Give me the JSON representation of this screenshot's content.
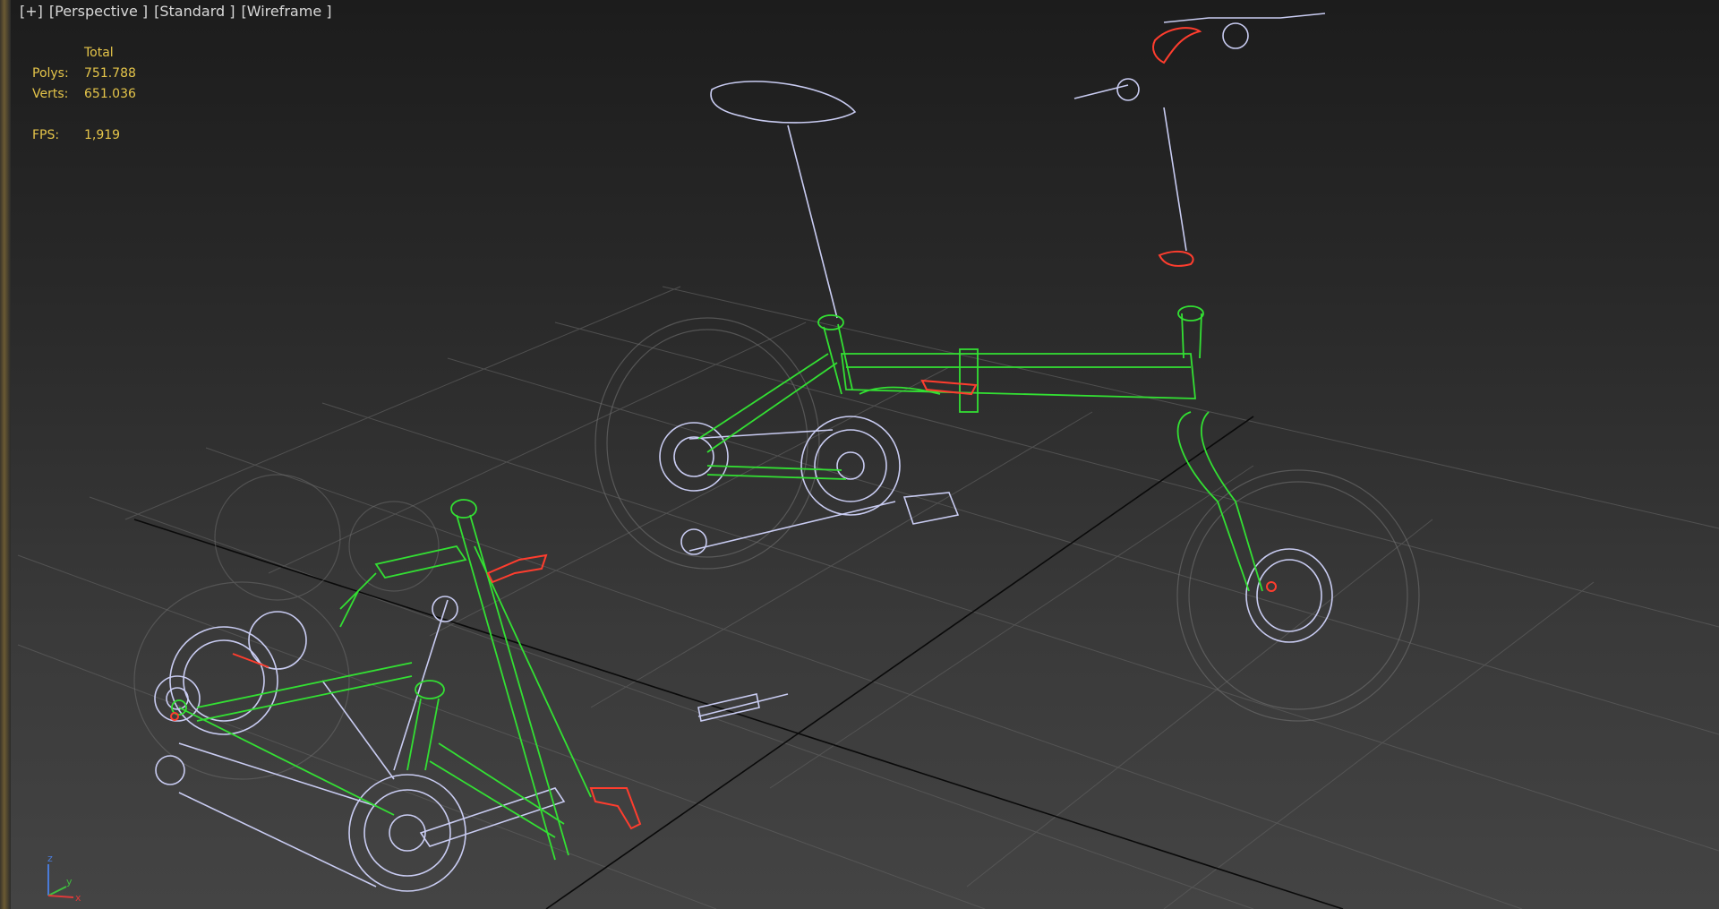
{
  "viewport": {
    "menu": [
      "[+]",
      "[Perspective ]",
      "[Standard ]",
      "[Wireframe ]"
    ],
    "stats": {
      "header": "Total",
      "rows": [
        {
          "label": "Polys:",
          "value": "751.788"
        },
        {
          "label": "Verts:",
          "value": "651.036"
        }
      ],
      "fps_label": "FPS:",
      "fps_value": "1,919"
    },
    "axis_gizmo": {
      "z": "z",
      "y": "y",
      "x": "x"
    }
  },
  "colors": {
    "wire_green": "#33e033",
    "wire_white": "#c9ccf2",
    "wire_red": "#ff3d2e",
    "grid": "#5a5a5a",
    "axis_line": "#0a0a0a",
    "stats_text": "#e5c54a"
  }
}
